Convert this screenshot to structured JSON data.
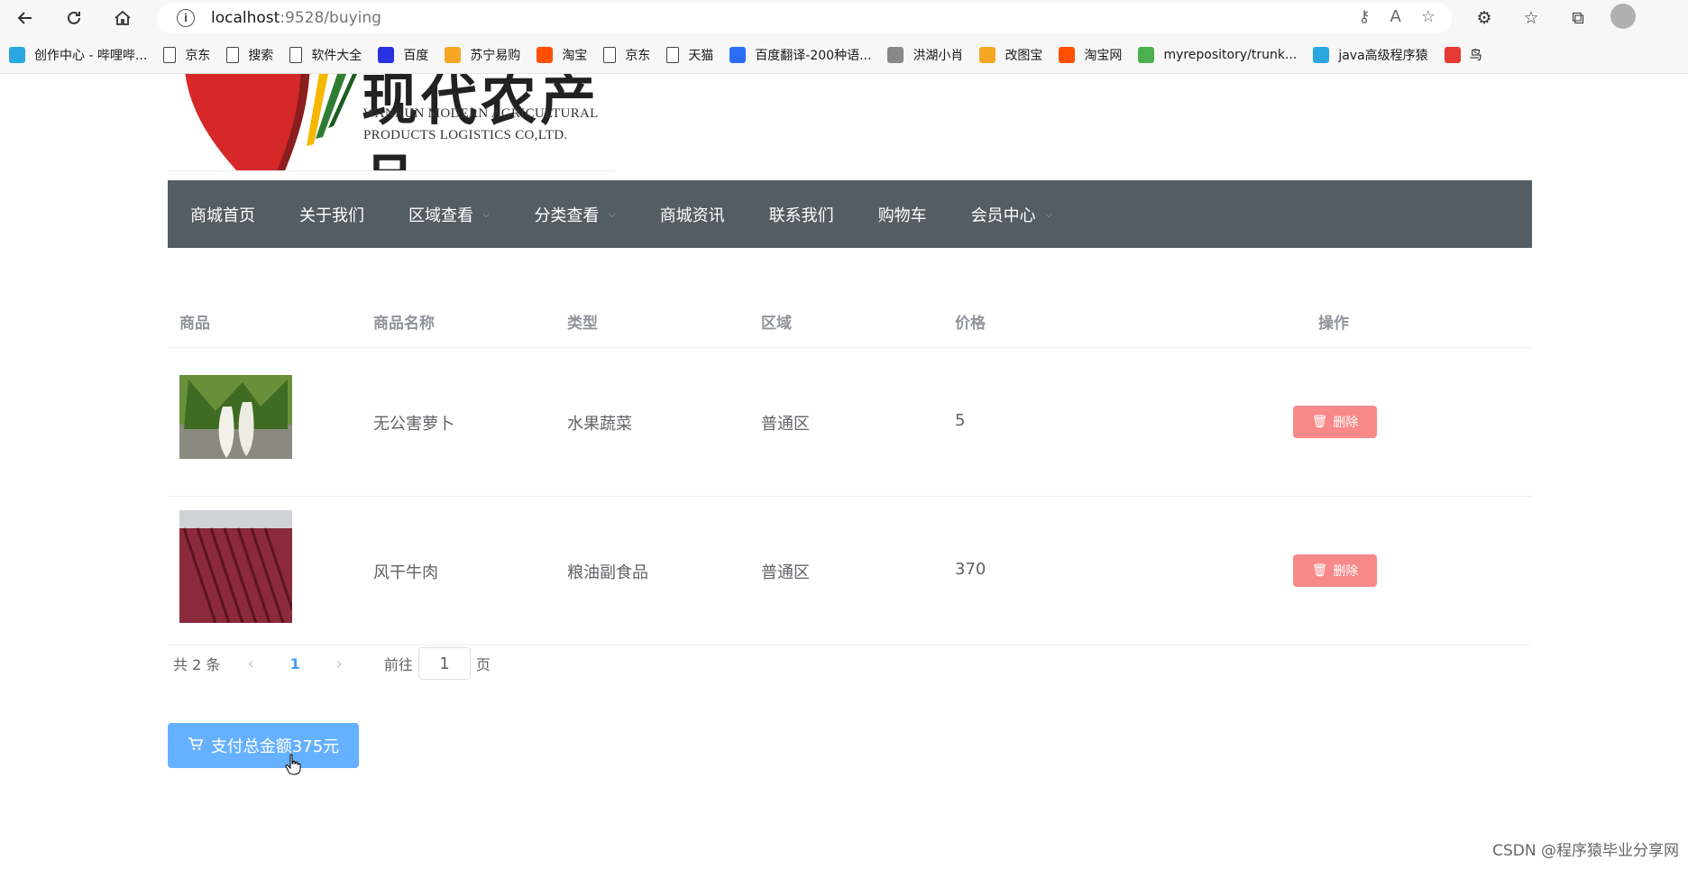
{
  "browser": {
    "url_host": "localhost",
    "url_rest": ":9528/buying",
    "bookmarks": [
      {
        "label": "创作中心 - 哔哩哔...",
        "icon": "bilibili-icon",
        "color": "#2aa6e0"
      },
      {
        "label": "京东",
        "icon": "page-icon",
        "color": ""
      },
      {
        "label": "搜索",
        "icon": "page-icon",
        "color": ""
      },
      {
        "label": "软件大全",
        "icon": "page-icon",
        "color": ""
      },
      {
        "label": "百度",
        "icon": "baidu-icon",
        "color": "#2932e1"
      },
      {
        "label": "苏宁易购",
        "icon": "suning-icon",
        "color": "#f5a623"
      },
      {
        "label": "淘宝",
        "icon": "taobao-icon",
        "color": "#ff5000"
      },
      {
        "label": "京东",
        "icon": "page-icon",
        "color": ""
      },
      {
        "label": "天猫",
        "icon": "page-icon",
        "color": ""
      },
      {
        "label": "百度翻译-200种语...",
        "icon": "baidu-translate-icon",
        "color": "#2b6ef5"
      },
      {
        "label": "洪湖小肖",
        "icon": "bird-icon",
        "color": "#888888"
      },
      {
        "label": "改图宝",
        "icon": "gaitubao-icon",
        "color": "#f5a623"
      },
      {
        "label": "淘宝网",
        "icon": "taobao-icon",
        "color": "#ff5000"
      },
      {
        "label": "myrepository/trunk...",
        "icon": "chrome-icon",
        "color": "#4caf50"
      },
      {
        "label": "java高级程序猿",
        "icon": "bilibili-icon",
        "color": "#2aa6e0"
      },
      {
        "label": "鸟",
        "icon": "bird-red-icon",
        "color": "#e53935"
      }
    ]
  },
  "logo": {
    "line1": "WANRUN MODERN AGRICULTURAL",
    "line2": "PRODUCTS  LOGISTICS CO,LTD.",
    "cn": "现代农产品"
  },
  "nav": {
    "items": [
      {
        "label": "商城首页",
        "dropdown": false
      },
      {
        "label": "关于我们",
        "dropdown": false
      },
      {
        "label": "区域查看",
        "dropdown": true
      },
      {
        "label": "分类查看",
        "dropdown": true
      },
      {
        "label": "商城资讯",
        "dropdown": false
      },
      {
        "label": "联系我们",
        "dropdown": false
      },
      {
        "label": "购物车",
        "dropdown": false
      },
      {
        "label": "会员中心",
        "dropdown": true
      }
    ]
  },
  "table": {
    "headers": [
      "商品",
      "商品名称",
      "类型",
      "区域",
      "价格",
      "操作"
    ],
    "rows": [
      {
        "name": "无公害萝卜",
        "type": "水果蔬菜",
        "region": "普通区",
        "price": "5",
        "action": "删除"
      },
      {
        "name": "风干牛肉",
        "type": "粮油副食品",
        "region": "普通区",
        "price": "370",
        "action": "删除"
      }
    ]
  },
  "pager": {
    "total": "共 2 条",
    "prev": "‹",
    "current": "1",
    "next": "›",
    "goto": "前往",
    "page_value": "1",
    "page_unit": "页"
  },
  "pay": {
    "label": "支付总金额375元"
  },
  "watermark": "CSDN @程序猿毕业分享网"
}
